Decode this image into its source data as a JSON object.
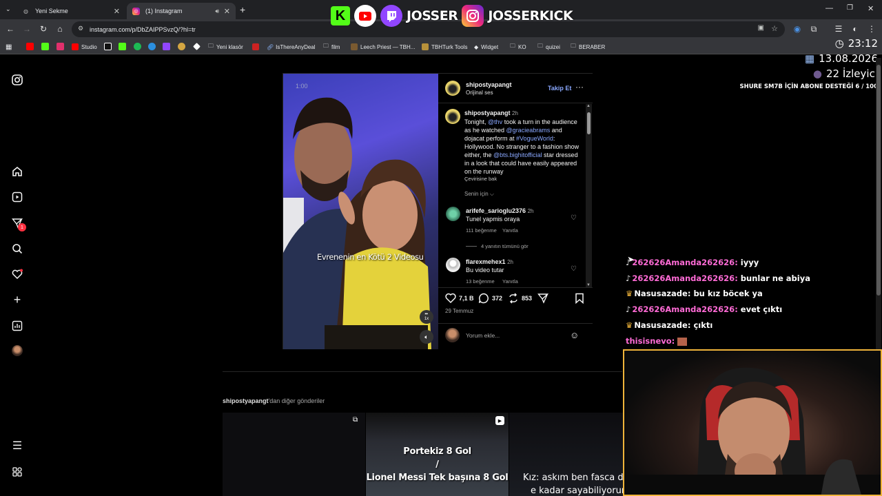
{
  "browser": {
    "tabs": [
      {
        "label": "Yeni Sekme",
        "active": false
      },
      {
        "label": "(1) Instagram",
        "active": true
      }
    ],
    "url": "instagram.com/p/DbZAIPPSvzQ/?hl=tr",
    "bookmarks": [
      "Studio",
      "Yeni klasör",
      "IsThereAnyDeal",
      "film",
      "Leech Priest — TBH...",
      "TBHTurk Tools",
      "Widget",
      "KO",
      "quizei",
      "BERABER"
    ]
  },
  "overlay": {
    "brand1": "JOSSER",
    "brand2": "JOSSERKICK",
    "time": "23:12",
    "date": "13.08.2026",
    "viewers": "22 İzleyici",
    "goal": "SHURE SM7B İÇİN ABONE DESTEĞİ 6 / 100"
  },
  "post": {
    "username": "shipostyapangt",
    "audio": "Orijinal ses",
    "follow": "Takip Et",
    "video_time": "1:00",
    "video_caption": "Evrenenin en Kötü 2 Videosu",
    "speed": "1x",
    "caption_user": "shipostyapangt",
    "caption_time": "2h",
    "caption_parts": [
      "Tonight, ",
      "@thv",
      " took a turn in the audience as he watched ",
      "@gracieabrams",
      " and dojacat perform at ",
      "#VogueWorld",
      ": Hollywood. No stranger to a fashion show either, the ",
      "@bts.bighitofficial",
      " star dressed in a look that could have easily appeared on the runway"
    ],
    "translate": "Çevirisine bak",
    "for_you": "Senin için",
    "comments": [
      {
        "user": "arifefe_sarioglu2376",
        "time": "2h",
        "text": "Tunel yapmis oraya",
        "likes": "111 beğenme",
        "reply": "Yanıtla"
      },
      {
        "user": "flarexmehex1",
        "time": "2h",
        "text": "Bu video tutar",
        "likes": "13 beğenme",
        "reply": "Yanıtla"
      }
    ],
    "view_replies": "4 yanıtın tümünü gör",
    "like_count": "7,1 B",
    "comment_count": "372",
    "share_count": "853",
    "date": "29 Temmuz",
    "comment_placeholder": "Yorum ekle..."
  },
  "more": {
    "title_user": "shipostyapangt",
    "title_rest": "'dan diğer gönderiler",
    "thumb2_line1": "Portekiz 8 Gol",
    "thumb2_line2": "/",
    "thumb2_line3": "Lionel Messi Tek başına 8 Gol",
    "thumb3_line1": "Kız: askım ben fasca d",
    "thumb3_line2": "e kadar sayabiliyorun"
  },
  "chat": [
    {
      "name": "262626Amanda262626",
      "msg": "iyyy",
      "badge": "note",
      "color": "#ff6bd6"
    },
    {
      "name": "262626Amanda262626",
      "msg": "bunlar ne abiya",
      "badge": "note",
      "color": "#ff6bd6"
    },
    {
      "name": "Nasusazade",
      "msg": "bu kız böcek ya",
      "badge": "crown",
      "color": "#ffffff"
    },
    {
      "name": "262626Amanda262626",
      "msg": "evet çıktı",
      "badge": "note",
      "color": "#ff6bd6"
    },
    {
      "name": "Nasusazade",
      "msg": "çıktı",
      "badge": "crown",
      "color": "#ffffff"
    },
    {
      "name": "thisisnevo",
      "msg": "",
      "badge": "",
      "color": "#ff6bd6"
    }
  ],
  "notification_count": "1"
}
